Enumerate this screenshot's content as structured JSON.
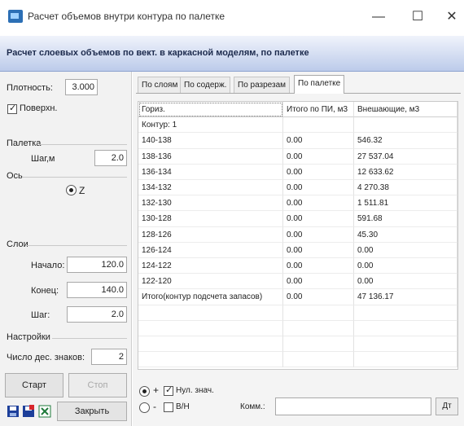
{
  "window": {
    "title": "Расчет объемов внутри контура по палетке",
    "minimize_glyph": "—",
    "maximize_glyph": "☐",
    "close_glyph": "✕"
  },
  "banner": {
    "text": "Расчет слоевых объемов по вект. в каркасной моделям, по палетке"
  },
  "left_panel": {
    "density_label": "Плотность:",
    "density_value": "3.000",
    "surface_label": "Поверхн.",
    "surface_checked": true,
    "palette_group": "Палетка",
    "step_m_label": "Шаг,м",
    "step_m_value": "2.0",
    "axis_group": "Ось",
    "axis_z_label": "Z",
    "layers_group": "Слои",
    "start_label": "Начало:",
    "start_value": "120.0",
    "end_label": "Конец:",
    "end_value": "140.0",
    "step_label": "Шаг:",
    "step_value": "2.0",
    "settings_group": "Настройки",
    "decimals_label": "Число дес. знаков:",
    "decimals_value": "2",
    "start_button": "Старт",
    "stop_button": "Стоп",
    "close_button": "Закрыть"
  },
  "tabs": [
    {
      "label": "По слоям",
      "active": false
    },
    {
      "label": "По содерж.",
      "active": false
    },
    {
      "label": "По разрезам",
      "active": false
    },
    {
      "label": "По палетке",
      "active": true
    }
  ],
  "table": {
    "columns": [
      "Гориз.",
      "Итого по ПИ, м3",
      "Внешающие, м3"
    ],
    "rows": [
      [
        "Контур: 1",
        "",
        ""
      ],
      [
        "140-138",
        "0.00",
        "546.32"
      ],
      [
        "138-136",
        "0.00",
        "27 537.04"
      ],
      [
        "136-134",
        "0.00",
        "12 633.62"
      ],
      [
        "134-132",
        "0.00",
        "4 270.38"
      ],
      [
        "132-130",
        "0.00",
        "1 511.81"
      ],
      [
        "130-128",
        "0.00",
        "591.68"
      ],
      [
        "128-126",
        "0.00",
        "45.30"
      ],
      [
        "126-124",
        "0.00",
        "0.00"
      ],
      [
        "124-122",
        "0.00",
        "0.00"
      ],
      [
        "122-120",
        "0.00",
        "0.00"
      ],
      [
        "Итого(контур подсчета запасов)",
        "0.00",
        "47 136.17"
      ],
      [
        "",
        "",
        ""
      ],
      [
        "",
        "",
        ""
      ],
      [
        "",
        "",
        ""
      ],
      [
        "",
        "",
        ""
      ]
    ]
  },
  "bottom": {
    "plus_label": "+",
    "minus_label": "-",
    "zero_label": "Нул. знач.",
    "zero_checked": true,
    "bn_label": "В/Н",
    "bn_checked": false,
    "comment_label": "Комм.:",
    "comment_value": "",
    "dt_button": "Дт"
  },
  "colors": {
    "banner_top": "#f0f3fb",
    "banner_bottom": "#bccbea",
    "icon_blue": "#2c6fb5"
  }
}
